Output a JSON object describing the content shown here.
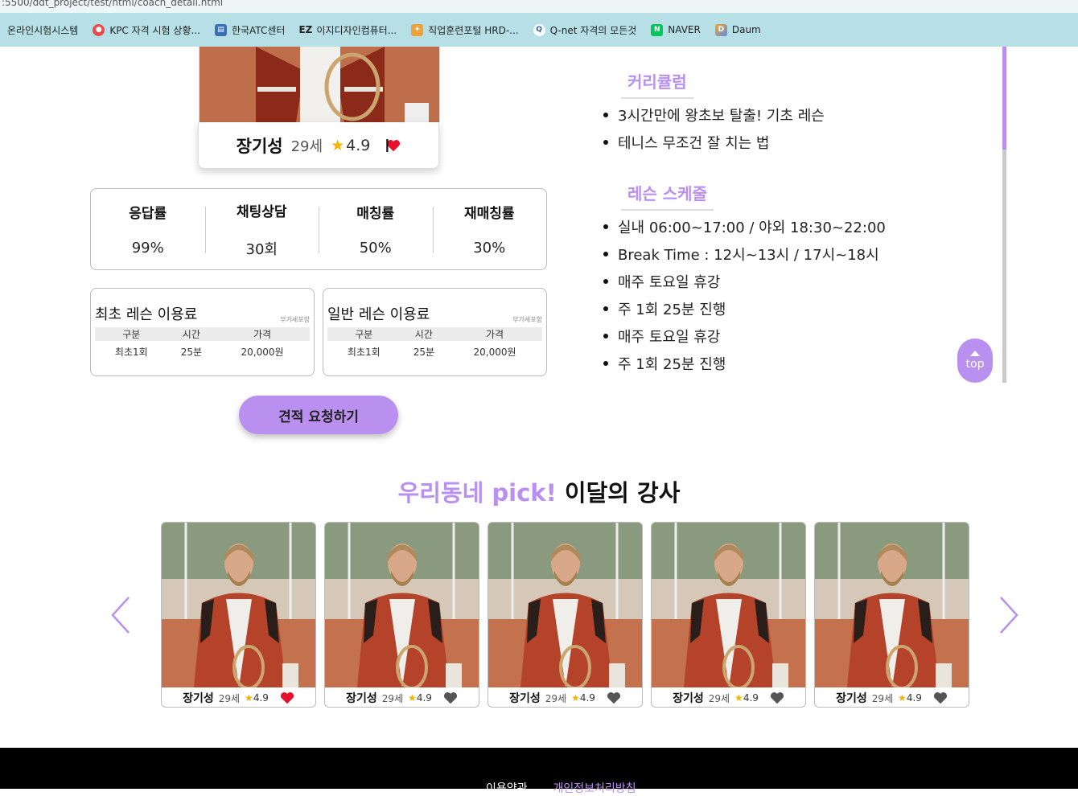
{
  "browser": {
    "url": ":5500/ddt_project/test/html/coach_detail.html",
    "bookmarks": [
      {
        "label": "온라인시험시스템",
        "icon": "none"
      },
      {
        "label": "KPC 자격 시험 상황...",
        "icon": "kpc-icon"
      },
      {
        "label": "한국ATC센터",
        "icon": "atc-icon"
      },
      {
        "label": "이지디자인컴퓨터...",
        "icon": "ez-icon"
      },
      {
        "label": "직업훈련포털 HRD-...",
        "icon": "hrd-icon"
      },
      {
        "label": "Q-net 자격의 모든것",
        "icon": "qnet-icon"
      },
      {
        "label": "NAVER",
        "icon": "naver-icon"
      },
      {
        "label": "Daum",
        "icon": "daum-icon"
      }
    ]
  },
  "coach": {
    "name": "장기성",
    "age": "29세",
    "rating": "4.9",
    "liked": true
  },
  "stats": [
    {
      "label": "응답률",
      "value": "99%"
    },
    {
      "label": "채팅상담",
      "value": "30회"
    },
    {
      "label": "매칭률",
      "value": "50%"
    },
    {
      "label": "재매칭률",
      "value": "30%"
    }
  ],
  "fees": [
    {
      "title": "최초 레슨 이용료",
      "vat": "부가세포함",
      "headers": [
        "구분",
        "시간",
        "가격"
      ],
      "row": [
        "최초1회",
        "25분",
        "20,000원"
      ]
    },
    {
      "title": "일반 레슨 이용료",
      "vat": "부가세포함",
      "headers": [
        "구분",
        "시간",
        "가격"
      ],
      "row": [
        "최초1회",
        "25분",
        "20,000원"
      ]
    }
  ],
  "quote_button": "견적 요청하기",
  "curriculum": {
    "title": "커리큘럼",
    "items": [
      "3시간만에 왕초보 탈출! 기초 레슨",
      "테니스 무조건 잘 치는 법"
    ]
  },
  "schedule": {
    "title": "레슨 스케줄",
    "items": [
      "실내 06:00~17:00 / 야외 18:30~22:00",
      "Break Time : 12시~13시 / 17시~18시",
      "매주 토요일 휴강",
      "주 1회 25분 진행",
      "매주 토요일 휴강",
      "주 1회 25분 진행"
    ]
  },
  "top_button": "top",
  "pick": {
    "title_accent": "우리동네 pick!",
    "title_rest": " 이달의 강사",
    "cards": [
      {
        "name": "장기성",
        "age": "29세",
        "rating": "4.9",
        "liked": true
      },
      {
        "name": "장기성",
        "age": "29세",
        "rating": "4.9",
        "liked": false
      },
      {
        "name": "장기성",
        "age": "29세",
        "rating": "4.9",
        "liked": false
      },
      {
        "name": "장기성",
        "age": "29세",
        "rating": "4.9",
        "liked": false
      },
      {
        "name": "장기성",
        "age": "29세",
        "rating": "4.9",
        "liked": false
      }
    ]
  },
  "footer": {
    "links": [
      "이용약관",
      "개인정보처리방침"
    ]
  },
  "colors": {
    "accent": "#b990f0",
    "bookmark_bar": "#b6e0e6",
    "star": "#f5b301",
    "heart_liked": "#e8112d",
    "heart_default": "#555555"
  }
}
